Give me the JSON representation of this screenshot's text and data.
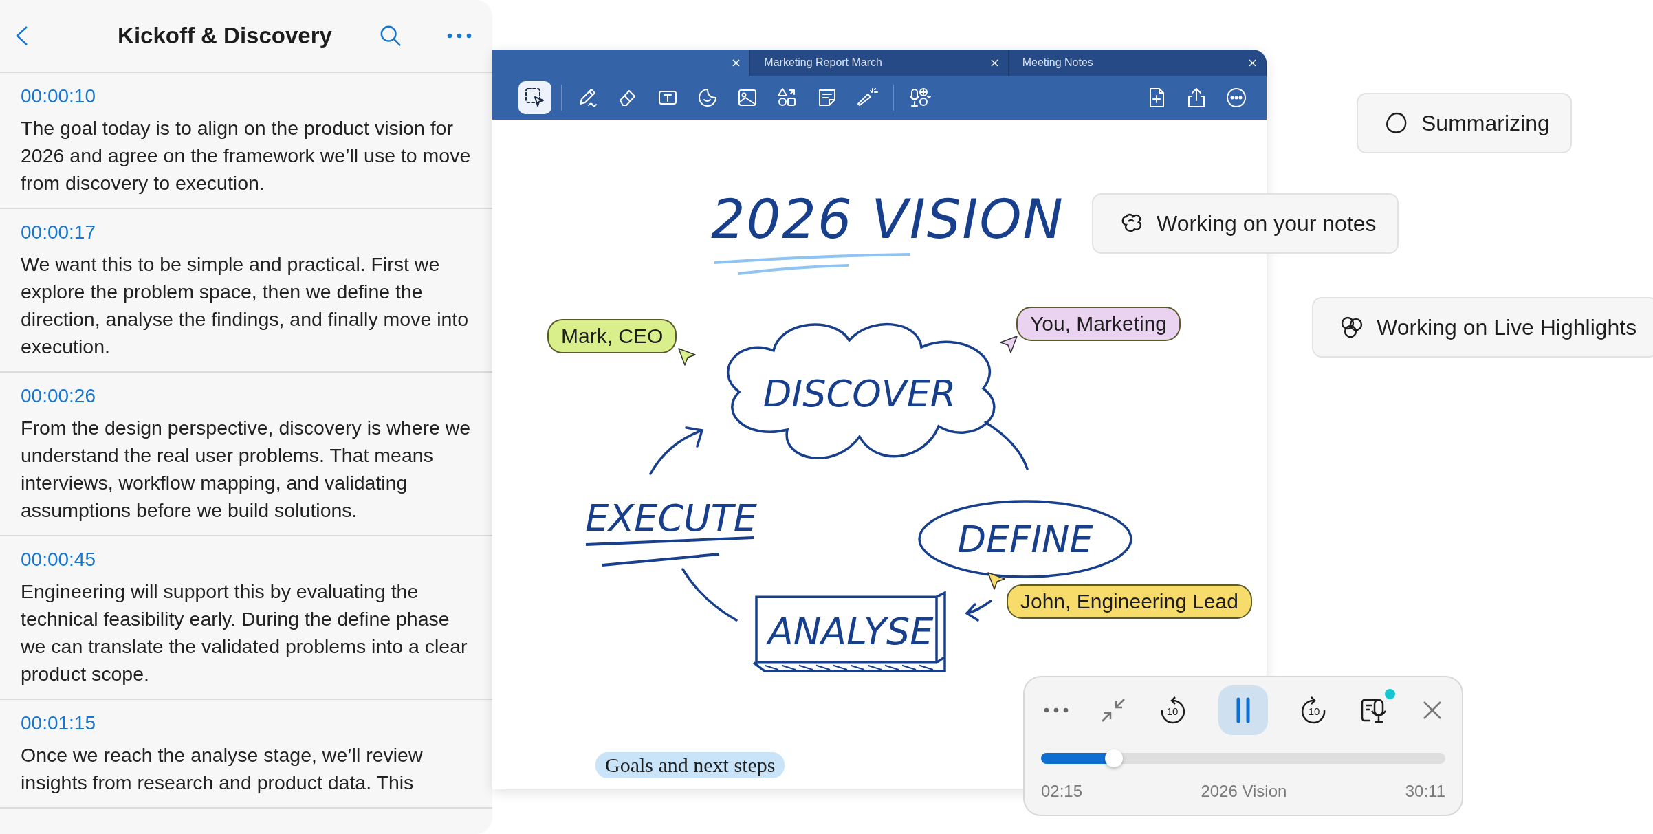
{
  "transcript": {
    "title": "Kickoff & Discovery",
    "entries": [
      {
        "time": "00:00:10",
        "text": "The goal today is to align on the product vision for 2026 and agree on the framework we’ll use to move from discovery to execution."
      },
      {
        "time": "00:00:17",
        "text": "We want this to be simple and practical. First we explore the problem space, then we define the direction, analyse the findings, and finally move into execution."
      },
      {
        "time": "00:00:26",
        "text": "From the design perspective, discovery is where we understand the real user problems. That means interviews, workflow mapping, and validating assumptions before we build solutions."
      },
      {
        "time": "00:00:45",
        "text": "Engineering will support this by evaluating the technical feasibility early. During the define phase we can translate the validated problems into a clear product scope."
      },
      {
        "time": "00:01:15",
        "text": "Once we reach the analyse stage, we’ll review insights from research and product data. This"
      }
    ]
  },
  "editor": {
    "tabs": [
      {
        "selected": true
      },
      {
        "label": "Marketing Report March",
        "selected": false
      },
      {
        "label": "Meeting Notes",
        "selected": false
      }
    ],
    "tools": [
      {
        "kind": "select",
        "selected": true
      },
      {
        "kind": "pen",
        "selected": false
      },
      {
        "kind": "eraser",
        "selected": false
      },
      {
        "kind": "text",
        "selected": false
      },
      {
        "kind": "sticker",
        "selected": false
      },
      {
        "kind": "image",
        "selected": false
      },
      {
        "kind": "shapes",
        "selected": false
      },
      {
        "kind": "note",
        "selected": false
      },
      {
        "kind": "laser",
        "selected": false
      },
      {
        "kind": "audio",
        "selected": false
      }
    ],
    "actions": [
      {
        "kind": "add-page"
      },
      {
        "kind": "share"
      },
      {
        "kind": "more"
      }
    ],
    "canvas": {
      "title": "2026 VISION",
      "nodes": [
        {
          "kind": "cloud",
          "label": "DISCOVER"
        },
        {
          "kind": "underline",
          "label": "EXECUTE"
        },
        {
          "kind": "ellipse",
          "label": "DEFINE"
        },
        {
          "kind": "box",
          "label": "ANALYSE"
        }
      ],
      "collaborators": [
        {
          "name": "Mark, CEO",
          "color": "#d8ef8c"
        },
        {
          "name": "You, Marketing",
          "color": "#ead3f1"
        },
        {
          "name": "John, Engineering Lead",
          "color": "#f7dc6b"
        }
      ],
      "caption": "Goals and next steps"
    }
  },
  "status": [
    {
      "kind": "summary",
      "label": "Summarizing"
    },
    {
      "kind": "notes",
      "label": "Working on your notes"
    },
    {
      "kind": "highlights",
      "label": "Working on Live Highlights"
    }
  ],
  "player": {
    "rewind": "10",
    "forward": "10",
    "playing": true,
    "live": true,
    "level": 0.18,
    "elapsed": "02:15",
    "title": "2026 Vision",
    "total": "30:11"
  }
}
